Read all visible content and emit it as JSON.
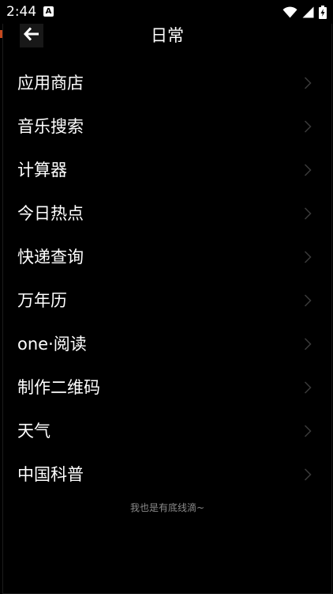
{
  "status_bar": {
    "time": "2:44",
    "notification_icon": "A",
    "icons": [
      "wifi-icon",
      "signal-icon",
      "battery-charging-icon"
    ]
  },
  "header": {
    "title": "日常",
    "back_icon": "arrow-left-icon"
  },
  "menu": {
    "items": [
      {
        "label": "应用商店"
      },
      {
        "label": "音乐搜索"
      },
      {
        "label": "计算器"
      },
      {
        "label": "今日热点"
      },
      {
        "label": "快递查询"
      },
      {
        "label": "万年历"
      },
      {
        "label": "one·阅读"
      },
      {
        "label": "制作二维码"
      },
      {
        "label": "天气"
      },
      {
        "label": "中国科普"
      }
    ],
    "chevron_icon": "chevron-right-icon"
  },
  "footer": {
    "text": "我也是有底线滴~"
  },
  "colors": {
    "background": "#000000",
    "text": "#ffffff",
    "chevron": "#3a3a3a",
    "footer_text": "#8a8a8a",
    "accent": "#c5481d"
  }
}
